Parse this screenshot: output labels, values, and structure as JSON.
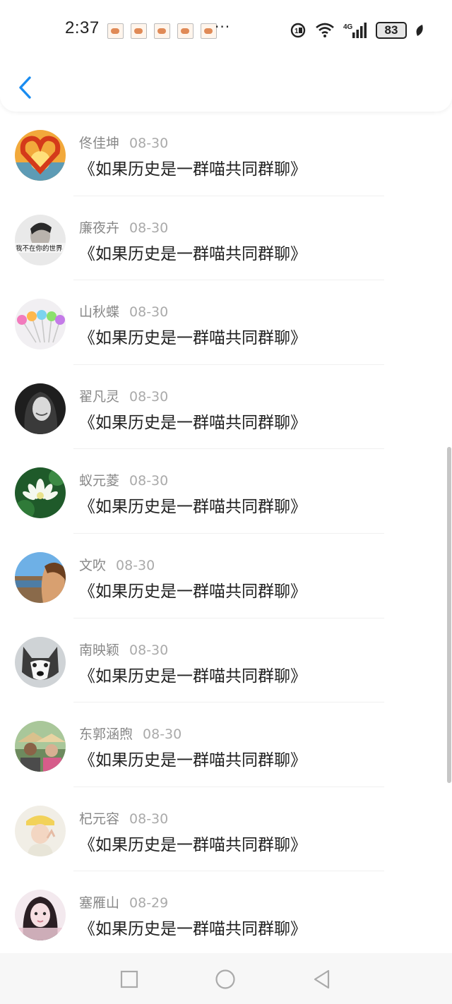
{
  "status_bar": {
    "time": "2:37",
    "overflow": "···",
    "battery": "83",
    "signal_label": "4G"
  },
  "header": {
    "back_icon": "chevron-left-icon"
  },
  "accent_color": "#1a8cf0",
  "items": [
    {
      "name": "佟佳坤",
      "date": "08-30",
      "message": "《如果历史是一群喵共同群聊》"
    },
    {
      "name": "廉夜卉",
      "date": "08-30",
      "message": "《如果历史是一群喵共同群聊》",
      "avatar_text": "我不在你的世界"
    },
    {
      "name": "山秋蝶",
      "date": "08-30",
      "message": "《如果历史是一群喵共同群聊》"
    },
    {
      "name": "翟凡灵",
      "date": "08-30",
      "message": "《如果历史是一群喵共同群聊》"
    },
    {
      "name": "蚁元菱",
      "date": "08-30",
      "message": "《如果历史是一群喵共同群聊》"
    },
    {
      "name": "文吹",
      "date": "08-30",
      "message": "《如果历史是一群喵共同群聊》"
    },
    {
      "name": "南映颖",
      "date": "08-30",
      "message": "《如果历史是一群喵共同群聊》"
    },
    {
      "name": "东郭涵煦",
      "date": "08-30",
      "message": "《如果历史是一群喵共同群聊》"
    },
    {
      "name": "杞元容",
      "date": "08-30",
      "message": "《如果历史是一群喵共同群聊》"
    },
    {
      "name": "塞雁山",
      "date": "08-29",
      "message": "《如果历史是一群喵共同群聊》"
    }
  ],
  "nav": {
    "icons": [
      "square-icon",
      "circle-icon",
      "triangle-back-icon"
    ]
  }
}
